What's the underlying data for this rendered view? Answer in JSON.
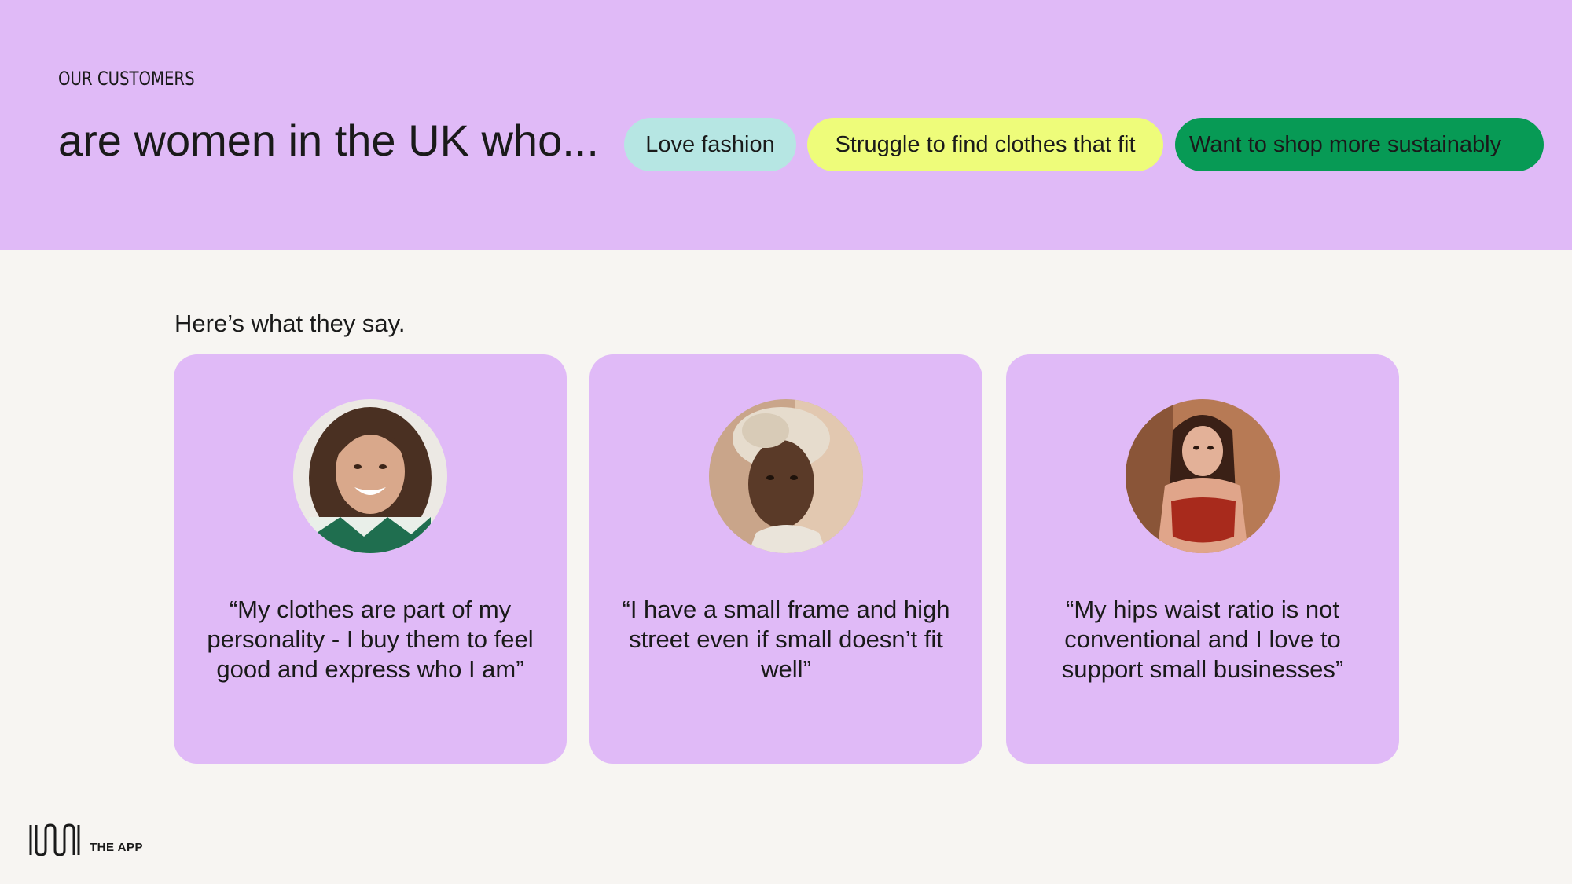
{
  "header": {
    "eyebrow": "OUR CUSTOMERS",
    "headline": "are women in the UK who...",
    "tags": [
      {
        "label": "Love fashion",
        "color": "#b6e6e3"
      },
      {
        "label": "Struggle to find clothes that fit",
        "color": "#eefc7a"
      },
      {
        "label": "Want to shop more sustainably",
        "color": "#079a55"
      }
    ]
  },
  "testimonials": {
    "intro": "Here’s what they say.",
    "cards": [
      {
        "quote": "“My clothes are part of my personality - I buy them to feel good and express who I am”",
        "avatar": "portrait-smiling-woman"
      },
      {
        "quote": "“I have a small frame and high street even if small doesn’t fit well”",
        "avatar": "portrait-woman-short-curly-hair"
      },
      {
        "quote": "“My hips waist ratio is not conventional and I love to support small businesses”",
        "avatar": "portrait-woman-red-top"
      }
    ]
  },
  "footer": {
    "logo_icon": "loom-logo-icon",
    "caption": "THE APP"
  },
  "colors": {
    "hero_bg": "#e0baf7",
    "page_bg": "#f7f5f2",
    "card_bg": "#e0baf7"
  }
}
